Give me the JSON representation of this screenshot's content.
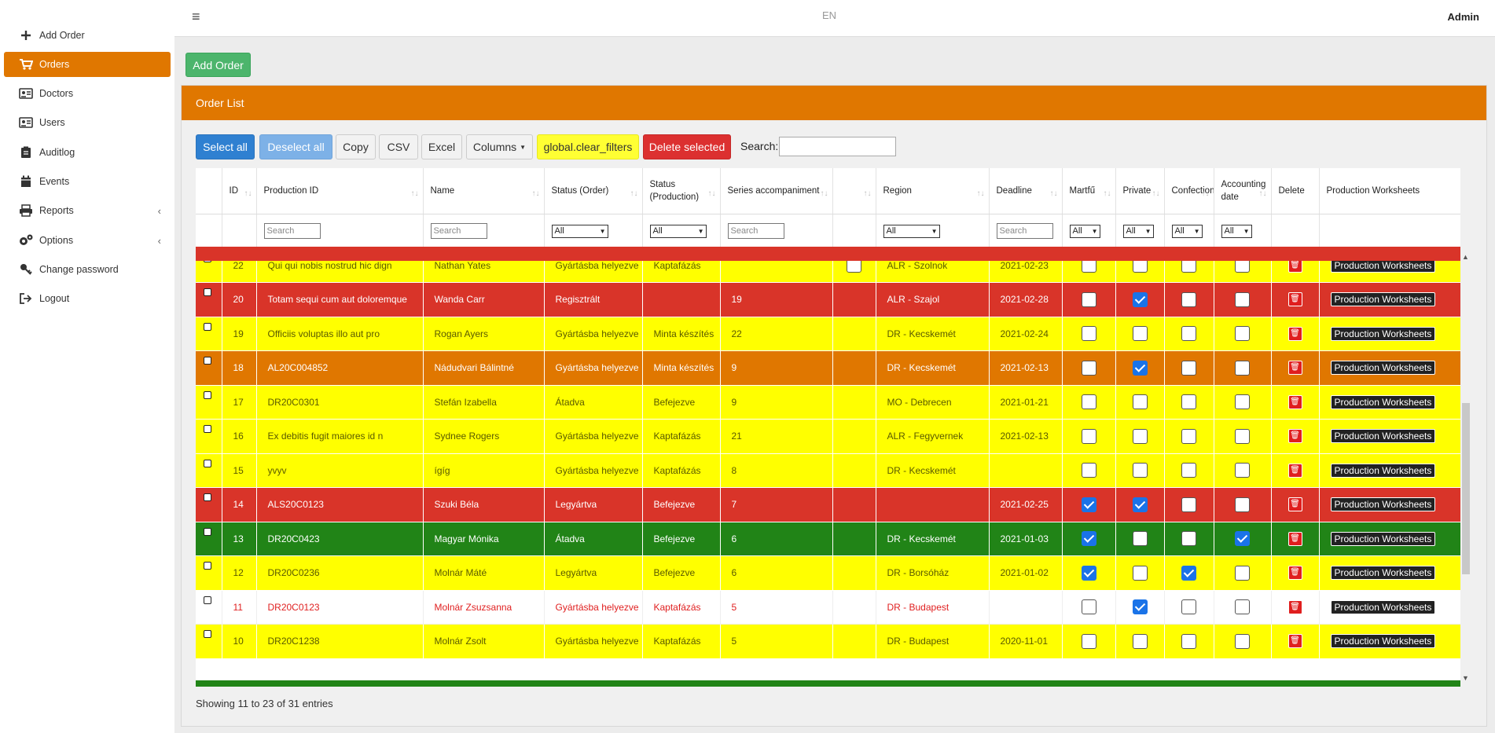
{
  "sidebar": {
    "items": [
      {
        "label": "Add Order",
        "icon": "plus-icon",
        "active": false
      },
      {
        "label": "Orders",
        "icon": "cart-icon",
        "active": true
      },
      {
        "label": "Doctors",
        "icon": "id-card-icon",
        "active": false
      },
      {
        "label": "Users",
        "icon": "id-card-icon",
        "active": false
      },
      {
        "label": "Auditlog",
        "icon": "clipboard-icon",
        "active": false
      },
      {
        "label": "Events",
        "icon": "calendar-icon",
        "active": false
      },
      {
        "label": "Reports",
        "icon": "printer-icon",
        "active": false,
        "chevron": "‹"
      },
      {
        "label": "Options",
        "icon": "gears-icon",
        "active": false,
        "chevron": "‹"
      },
      {
        "label": "Change password",
        "icon": "key-icon",
        "active": false
      },
      {
        "label": "Logout",
        "icon": "logout-icon",
        "active": false
      }
    ]
  },
  "topbar": {
    "menu_icon": "≡",
    "language": "EN",
    "user": "Admin"
  },
  "add_order_button": "Add Order",
  "card": {
    "title": "Order List",
    "buttons": {
      "select_all": "Select all",
      "deselect_all": "Deselect all",
      "copy": "Copy",
      "csv": "CSV",
      "excel": "Excel",
      "columns": "Columns",
      "clear_filters": "global.clear_filters",
      "delete_selected": "Delete selected"
    },
    "search_label": "Search:",
    "search_value": ""
  },
  "table": {
    "columns": [
      {
        "label": "",
        "sortable": false
      },
      {
        "label": "ID",
        "sortable": true
      },
      {
        "label": "Production ID",
        "sortable": true
      },
      {
        "label": "Name",
        "sortable": true
      },
      {
        "label": "Status (Order)",
        "sortable": true
      },
      {
        "label": "Status (Production)",
        "sortable": true
      },
      {
        "label": "Series accompaniment",
        "sortable": true
      },
      {
        "label": "",
        "sortable": true
      },
      {
        "label": "Region",
        "sortable": true
      },
      {
        "label": "Deadline",
        "sortable": true
      },
      {
        "label": "Martfű",
        "sortable": true
      },
      {
        "label": "Private",
        "sortable": true
      },
      {
        "label": "Confection",
        "sortable": true
      },
      {
        "label": "Accounting date",
        "sortable": true
      },
      {
        "label": "Delete",
        "sortable": false
      },
      {
        "label": "Production Worksheets",
        "sortable": false
      }
    ],
    "filters": {
      "search_placeholder": "Search",
      "select_all": "All"
    },
    "pw_label": "Production Worksheets",
    "rows": [
      {
        "color": "yellow",
        "id": "22",
        "prod_id": "Qui qui nobis nostrud hic dign",
        "name": "Nathan Yates",
        "status_order": "Gyártásba helyezve",
        "status_prod": "Kaptafázás",
        "series": "",
        "extra": true,
        "region": "ALR - Szolnok",
        "deadline": "2021-02-23",
        "martfu": false,
        "private": false,
        "confection": false,
        "accounting": false
      },
      {
        "color": "red",
        "id": "20",
        "prod_id": "Totam sequi cum aut doloremque",
        "name": "Wanda Carr",
        "status_order": "Regisztrált",
        "status_prod": "",
        "series": "19",
        "extra": false,
        "region": "ALR - Szajol",
        "deadline": "2021-02-28",
        "martfu": false,
        "private": true,
        "confection": false,
        "accounting": false
      },
      {
        "color": "yellow",
        "id": "19",
        "prod_id": "Officiis voluptas illo aut pro",
        "name": "Rogan Ayers",
        "status_order": "Gyártásba helyezve",
        "status_prod": "Minta készítés",
        "series": "22",
        "extra": false,
        "region": "DR - Kecskemét",
        "deadline": "2021-02-24",
        "martfu": false,
        "private": false,
        "confection": false,
        "accounting": false
      },
      {
        "color": "orange",
        "id": "18",
        "prod_id": "AL20C004852",
        "name": "Nádudvari Bálintné",
        "status_order": "Gyártásba helyezve",
        "status_prod": "Minta készítés",
        "series": "9",
        "extra": false,
        "region": "DR - Kecskemét",
        "deadline": "2021-02-13",
        "martfu": false,
        "private": true,
        "confection": false,
        "accounting": false
      },
      {
        "color": "yellow",
        "id": "17",
        "prod_id": "DR20C0301",
        "name": "Stefán Izabella",
        "status_order": "Átadva",
        "status_prod": "Befejezve",
        "series": "9",
        "extra": false,
        "region": "MO - Debrecen",
        "deadline": "2021-01-21",
        "martfu": false,
        "private": false,
        "confection": false,
        "accounting": false
      },
      {
        "color": "yellow",
        "id": "16",
        "prod_id": "Ex debitis fugit maiores id n",
        "name": "Sydnee Rogers",
        "status_order": "Gyártásba helyezve",
        "status_prod": "Kaptafázás",
        "series": "21",
        "extra": false,
        "region": "ALR - Fegyvernek",
        "deadline": "2021-02-13",
        "martfu": false,
        "private": false,
        "confection": false,
        "accounting": false
      },
      {
        "color": "yellow",
        "id": "15",
        "prod_id": "yvyv",
        "name": "ígíg",
        "status_order": "Gyártásba helyezve",
        "status_prod": "Kaptafázás",
        "series": "8",
        "extra": false,
        "region": "DR - Kecskemét",
        "deadline": "",
        "martfu": false,
        "private": false,
        "confection": false,
        "accounting": false
      },
      {
        "color": "red",
        "id": "14",
        "prod_id": "ALS20C0123",
        "name": "Szuki Béla",
        "status_order": "Legyártva",
        "status_prod": "Befejezve",
        "series": "7",
        "extra": false,
        "region": "",
        "deadline": "2021-02-25",
        "martfu": true,
        "private": true,
        "confection": false,
        "accounting": false
      },
      {
        "color": "green",
        "id": "13",
        "prod_id": "DR20C0423",
        "name": "Magyar Mónika",
        "status_order": "Átadva",
        "status_prod": "Befejezve",
        "series": "6",
        "extra": false,
        "region": "DR - Kecskemét",
        "deadline": "2021-01-03",
        "martfu": true,
        "private": false,
        "confection": false,
        "accounting": true
      },
      {
        "color": "yellow",
        "id": "12",
        "prod_id": "DR20C0236",
        "name": "Molnár Máté",
        "status_order": "Legyártva",
        "status_prod": "Befejezve",
        "series": "6",
        "extra": false,
        "region": "DR - Borsóház",
        "deadline": "2021-01-02",
        "martfu": true,
        "private": false,
        "confection": true,
        "accounting": false
      },
      {
        "color": "white",
        "id": "11",
        "prod_id": "DR20C0123",
        "name": "Molnár Zsuzsanna",
        "status_order": "Gyártásba helyezve",
        "status_prod": "Kaptafázás",
        "series": "5",
        "extra": false,
        "region": "DR - Budapest",
        "deadline": "",
        "martfu": false,
        "private": true,
        "confection": false,
        "accounting": false
      },
      {
        "color": "yellow",
        "id": "10",
        "prod_id": "DR20C1238",
        "name": "Molnár Zsolt",
        "status_order": "Gyártásba helyezve",
        "status_prod": "Kaptafázás",
        "series": "5",
        "extra": false,
        "region": "DR - Budapest",
        "deadline": "2020-11-01",
        "martfu": false,
        "private": false,
        "confection": false,
        "accounting": false
      }
    ]
  },
  "info": "Showing 11 to 23 of 31 entries"
}
